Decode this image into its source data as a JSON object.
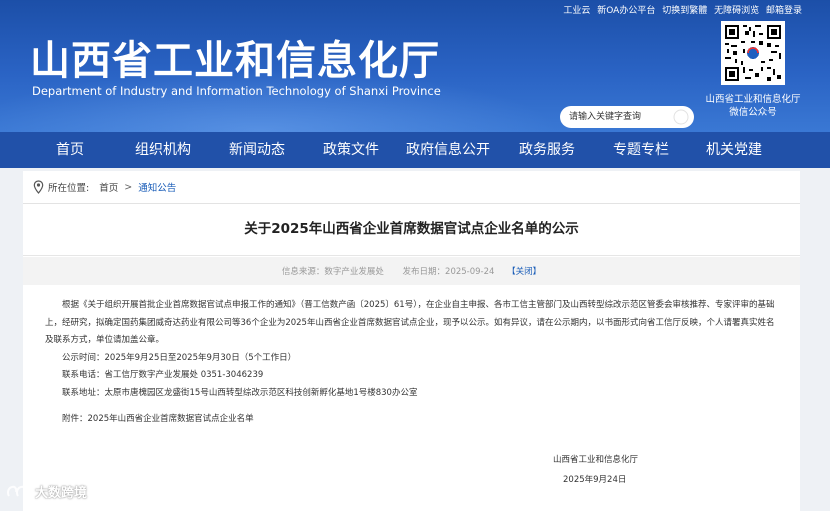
{
  "header": {
    "top_links": [
      "工业云",
      "新OA办公平台",
      "切换到繁體",
      "无障碍浏览",
      "邮箱登录"
    ],
    "title_cn": "山西省工业和信息化厅",
    "title_en": "Department of Industry and Information Technology of Shanxi Province",
    "qr_caption_line1": "山西省工业和信息化厅",
    "qr_caption_line2": "微信公众号",
    "search_placeholder": "请输入关键字查询"
  },
  "nav": {
    "items": [
      "首页",
      "组织机构",
      "新闻动态",
      "政策文件",
      "政府信息公开",
      "政务服务",
      "专题专栏",
      "机关党建"
    ]
  },
  "breadcrumb": {
    "label": "所在位置:",
    "home": "首页",
    "separator": ">",
    "current": "通知公告"
  },
  "article": {
    "title": "关于2025年山西省企业首席数据官试点企业名单的公示",
    "source": "信息来源：数字产业发展处",
    "date": "发布日期：2025-09-24",
    "close_label": "【关闭】",
    "paragraph1": "根据《关于组织开展首批企业首席数据官试点申报工作的通知》（晋工信数产函〔2025〕61号），在企业自主申报、各市工信主管部门及山西转型综改示范区管委会审核推荐、专家评审的基础上，经研究，拟确定国药集团威奇达药业有限公司等36个企业为2025年山西省企业首席数据官试点企业，现予以公示。如有异议，请在公示期内，以书面形式向省工信厅反映，个人请署真实姓名及联系方式，单位请加盖公章。",
    "period": "公示时间：2025年9月25日至2025年9月30日（5个工作日）",
    "phone": "联系电话：省工信厅数字产业发展处 0351-3046239",
    "address": "联系地址：太原市唐槐园区龙盛街15号山西转型综改示范区科技创新孵化基地1号楼830办公室",
    "attachment": "附件：2025年山西省企业首席数据官试点企业名单",
    "signature": "山西省工业和信息化厅",
    "sign_date": "2025年9月24日"
  },
  "watermark": "大数跨境"
}
